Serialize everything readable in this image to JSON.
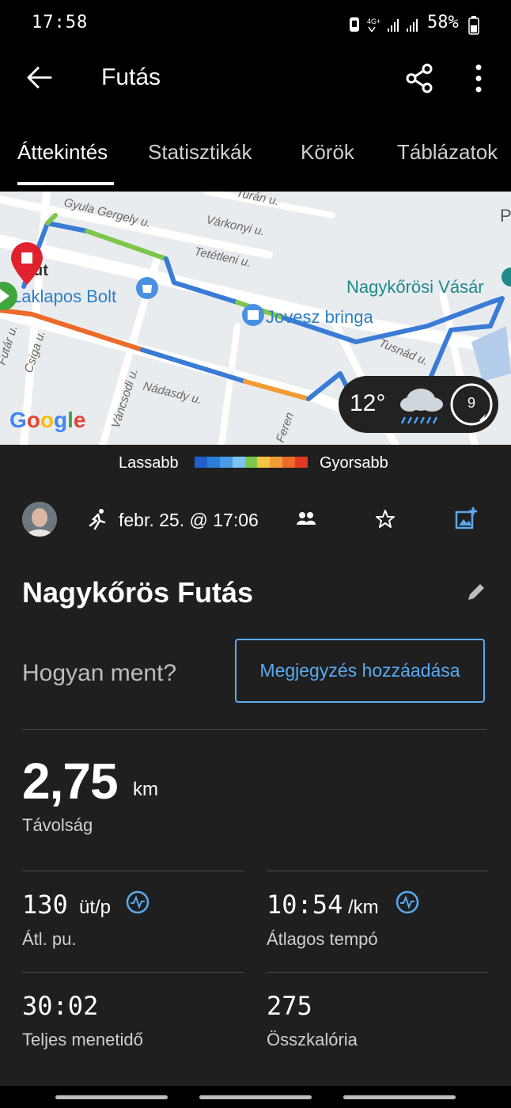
{
  "status_bar": {
    "time": "17:58",
    "battery": "58%",
    "network": "4G+"
  },
  "app_bar": {
    "title": "Futás"
  },
  "tabs": [
    {
      "label": "Áttekintés",
      "active": true
    },
    {
      "label": "Statisztikák",
      "active": false
    },
    {
      "label": "Körök",
      "active": false
    },
    {
      "label": "Táblázatok",
      "active": false
    }
  ],
  "map": {
    "streets": {
      "gyulai": "Gyula Gergely u.",
      "turan": "Turán u.",
      "varkonyi": "Várkonyi u.",
      "tetetleni": "Tetétleni u.",
      "nadasdy": "Nádasdy u.",
      "vancsodi": "Váncsodi u.",
      "csiga": "Csiga u.",
      "futar": "Futár u.",
      "tusnad": "Tusnád u.",
      "fered": "Feren"
    },
    "pois": {
      "bolt": "Laklapos Bolt",
      "vasar": "Nagykőrösi Vásár",
      "bringa": "Jovesz bringa",
      "ut": "út",
      "p": "P"
    },
    "provider": "Google",
    "weather": {
      "temperature": "12°",
      "wind": "9",
      "icon": "rain-cloud-icon"
    }
  },
  "legend": {
    "slower": "Lassabb",
    "faster": "Gyorsabb",
    "colors": [
      "#1f5fc8",
      "#2b7ddc",
      "#4a9ae6",
      "#7cc4f0",
      "#7dc64b",
      "#f4c542",
      "#f39c33",
      "#ec6a2a",
      "#e03a24"
    ]
  },
  "activity": {
    "date": "febr. 25. @ 17:06",
    "name": "Nagykőrös Futás",
    "how_label": "Hogyan ment?",
    "note_button": "Megjegyzés hozzáadása"
  },
  "stats": {
    "distance": {
      "value": "2,75",
      "unit": "km",
      "label": "Távolság"
    },
    "cadence": {
      "value": "130",
      "unit": "üt/p",
      "label": "Átl. pu."
    },
    "pace": {
      "value": "10:54",
      "unit": "/km",
      "label": "Átlagos tempó"
    },
    "time": {
      "value": "30:02",
      "label": "Teljes menetidő"
    },
    "calories": {
      "value": "275",
      "label": "Összkalória"
    }
  },
  "colors": {
    "accent": "#5aa9f0",
    "background": "#1f1f1f",
    "bar": "#000000"
  }
}
